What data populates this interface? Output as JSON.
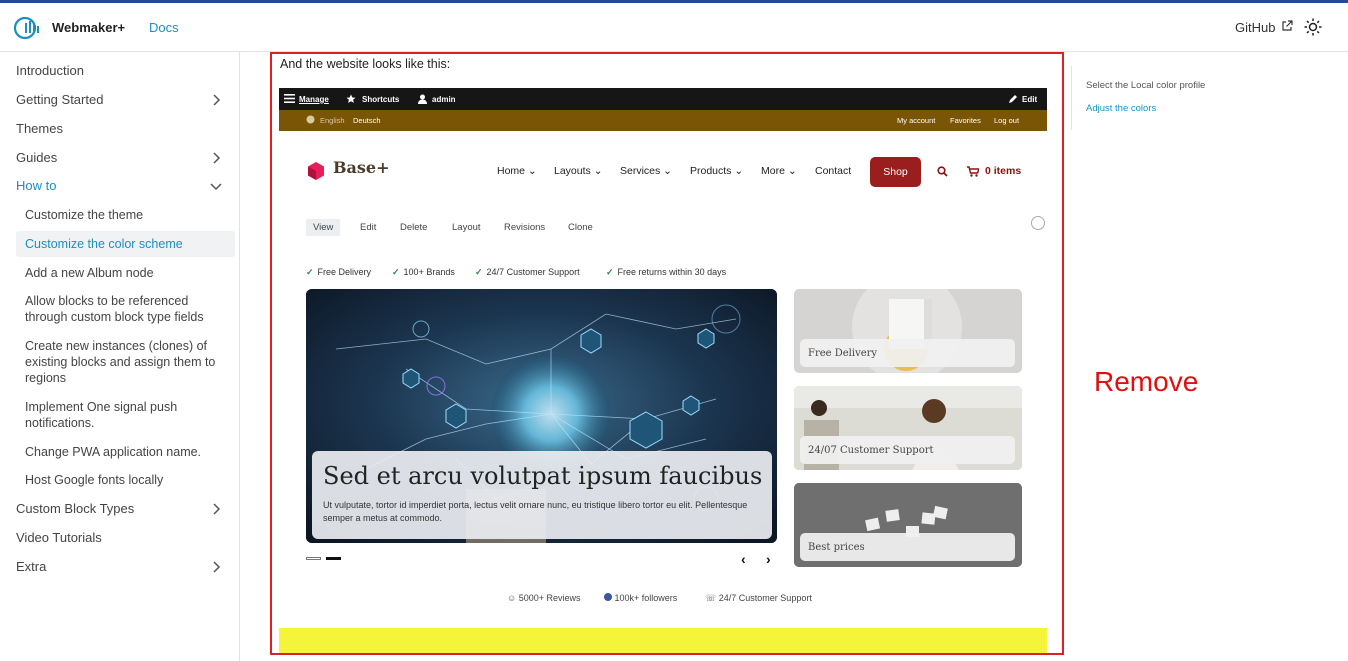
{
  "header": {
    "brand": "Webmaker+",
    "docs_link": "Docs",
    "github_link": "GitHub",
    "icons": [
      "webmaker-logo-icon",
      "external-link-icon",
      "sun-theme-icon"
    ]
  },
  "sidebar": {
    "items": [
      {
        "label": "Introduction"
      },
      {
        "label": "Getting Started"
      },
      {
        "label": "Themes"
      },
      {
        "label": "Guides"
      },
      {
        "label": "How to"
      },
      {
        "label": "Custom Block Types"
      },
      {
        "label": "Video Tutorials"
      },
      {
        "label": "Extra"
      }
    ],
    "subitems": [
      {
        "label": "Customize the theme"
      },
      {
        "label": "Customize the color scheme"
      },
      {
        "label": "Add a new Album node"
      },
      {
        "label": "Allow blocks to be referenced through custom block type fields"
      },
      {
        "label": "Create new instances (clones) of existing blocks and assign them to regions"
      },
      {
        "label": "Implement One signal push notifications."
      },
      {
        "label": "Change PWA application name."
      },
      {
        "label": "Host Google fonts locally"
      }
    ]
  },
  "main": {
    "intro": "And the website looks like this:"
  },
  "site": {
    "admin_bar": {
      "manage": "Manage",
      "shortcuts": "Shortcuts",
      "user": "admin",
      "edit": "Edit"
    },
    "lang_bar": {
      "english": "English",
      "deutsch": "Deutsch",
      "my_account": "My account",
      "favorites": "Favorites",
      "logout": "Log out"
    },
    "logo_text": "Base+",
    "menu": [
      "Home",
      "Layouts",
      "Services",
      "Products",
      "More",
      "Contact"
    ],
    "shop_label": "Shop",
    "cart_label": "0 items",
    "tabs": [
      "View",
      "Edit",
      "Delete",
      "Layout",
      "Revisions",
      "Clone"
    ],
    "features": [
      "Free Delivery",
      "100+ Brands",
      "24/7 Customer Support",
      "Free returns within 30 days"
    ],
    "hero": {
      "title": "Sed et arcu volutpat ipsum faucibus",
      "text": "Ut vulputate, tortor id imperdiet porta, lectus velit ornare nunc, eu tristique libero tortor eu elit. Pellentesque semper a metus at commodo."
    },
    "cards": [
      {
        "label": "Free Delivery"
      },
      {
        "label": "24/07 Customer Support"
      },
      {
        "label": "Best prices"
      }
    ],
    "stats": [
      "5000+ Reviews",
      "100k+ followers",
      "24/7 Customer Support"
    ],
    "colors": {
      "accent": "#9b1e1e",
      "lang_bar": "#7a5505",
      "yellow": "#f4f43a"
    }
  },
  "toc": {
    "items": [
      {
        "label": "Select the Local color profile"
      },
      {
        "label": "Adjust the colors"
      }
    ]
  },
  "annotation": "Remove"
}
